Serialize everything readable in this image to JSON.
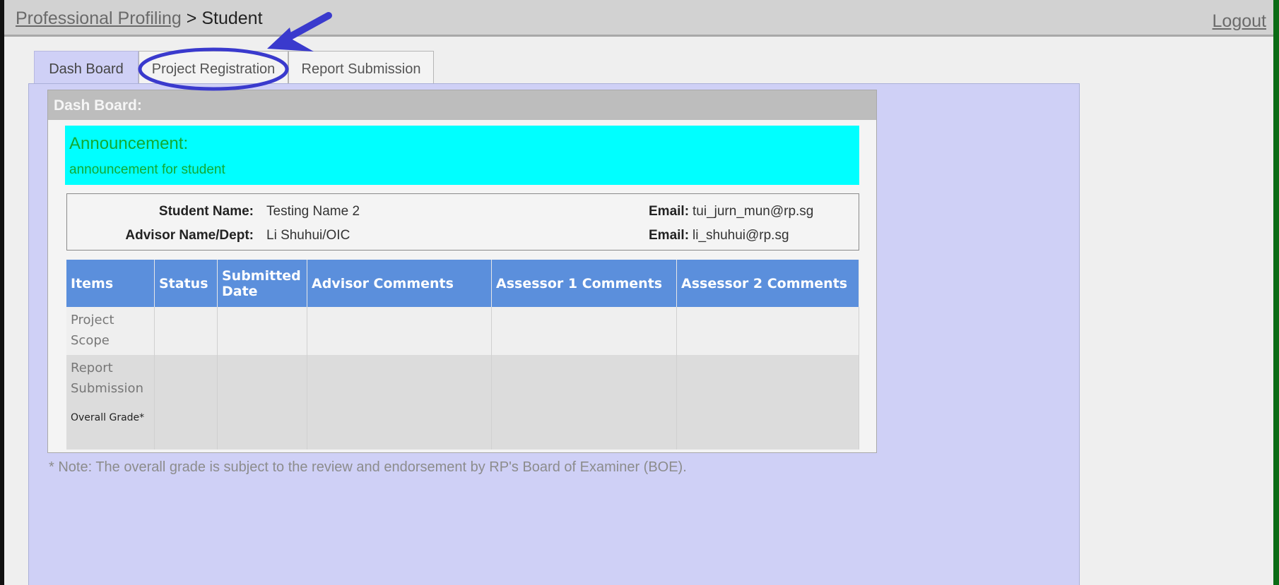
{
  "header": {
    "breadcrumb_link": "Professional Profiling",
    "breadcrumb_sep": " > ",
    "breadcrumb_current": "Student",
    "logout": "Logout"
  },
  "tabs": [
    {
      "label": "Dash Board",
      "active": true
    },
    {
      "label": "Project Registration",
      "active": false
    },
    {
      "label": "Report Submission",
      "active": false
    }
  ],
  "dashboard": {
    "title": "Dash Board:",
    "announcement_title": "Announcement:",
    "announcement_text": "announcement for student",
    "student_name_label": "Student Name:",
    "student_name": "Testing Name 2",
    "student_email_label": "Email:",
    "student_email": "tui_jurn_mun@rp.sg",
    "advisor_label": "Advisor Name/Dept:",
    "advisor_name": "Li Shuhui/OIC",
    "advisor_email_label": "Email:",
    "advisor_email": "li_shuhui@rp.sg"
  },
  "table": {
    "headers": [
      "Items",
      "Status",
      "Submitted Date",
      "Advisor Comments",
      "Assessor 1 Comments",
      "Assessor 2 Comments"
    ],
    "rows": [
      {
        "item": "Project Scope"
      },
      {
        "item": "Report Submission"
      },
      {
        "item": "Overall Grade*"
      }
    ]
  },
  "note": "* Note: The overall grade is subject to the review and endorsement by RP's Board of Examiner (BOE).",
  "colors": {
    "annotation": "#3a3acd",
    "panel": "#cfd0f6",
    "announcement_bg": "#00ffff",
    "table_header": "#5b8fdc",
    "announcement_text": "#11aa33"
  }
}
